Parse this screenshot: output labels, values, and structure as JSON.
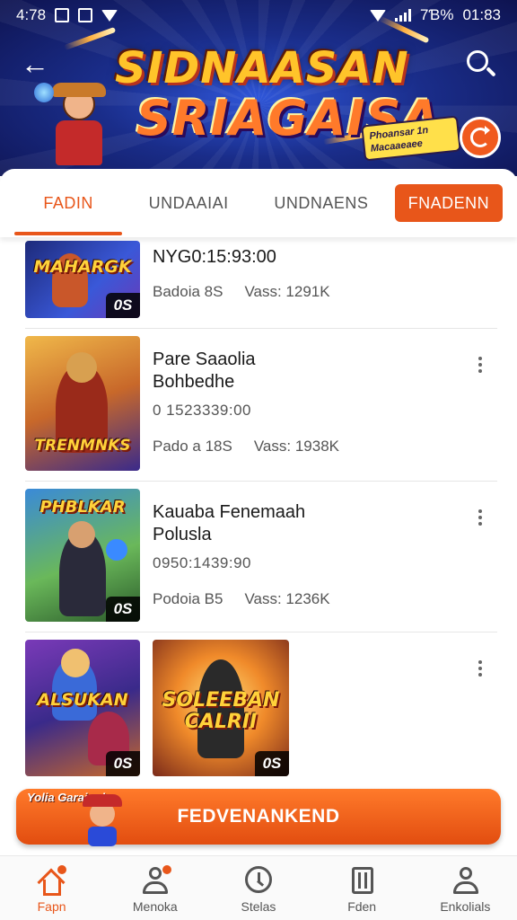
{
  "status_bar": {
    "time": "4:78",
    "battery": "7Ɓ%",
    "clock": "01:83"
  },
  "banner": {
    "title_line1": "SIDNAASAN",
    "title_line2": "SRIAGAISA",
    "promo_tag": "Phoansar 1n Macaaeaee",
    "icons": {
      "back": "arrow-left-icon",
      "search": "search-icon",
      "refresh": "refresh-icon"
    }
  },
  "tabs": [
    {
      "label": "FADIN",
      "active": true
    },
    {
      "label": "UNDAAIAI",
      "active": false
    },
    {
      "label": "UNDNAENS",
      "active": false
    },
    {
      "label": "FNADENN",
      "highlighted": true
    }
  ],
  "items": [
    {
      "thumb_title": "MAHARGK",
      "badge": "0S",
      "name_line1": "NYG0:15:93:00",
      "name_line2": "",
      "time": "",
      "meta_left": "Badoia 8S",
      "meta_right": "Vass: 1291K"
    },
    {
      "thumb_title": "TRENMNKS",
      "badge": "",
      "name_line1": "Pare Saaolia",
      "name_line2": "Bohbedhe",
      "time": "0 1523339:00",
      "meta_left": "Pado a 18S",
      "meta_right": "Vass: 1938K"
    },
    {
      "thumb_title": "PHBLKAR",
      "badge": "0S",
      "name_line1": "Kauaba Fenemaah",
      "name_line2": "Polusla",
      "time": "0950:1439:90",
      "meta_left": "Podoia B5",
      "meta_right": "Vass: 1236K"
    },
    {
      "thumb_title": "ALSUKAN",
      "badge": "0S",
      "thumb2_title": "SOLEEBAN CALRII",
      "thumb2_badge": "0S"
    }
  ],
  "cta": {
    "art_text": "Yolia Garaiuol",
    "label": "FEDVENANKEND"
  },
  "bottom_nav": [
    {
      "label": "Fapn",
      "icon": "home-icon",
      "active": true
    },
    {
      "label": "Menoka",
      "icon": "user-icon",
      "active": false
    },
    {
      "label": "Stelas",
      "icon": "clock-icon",
      "active": false
    },
    {
      "label": "Fden",
      "icon": "box-icon",
      "active": false
    },
    {
      "label": "Enkolials",
      "icon": "profile-icon",
      "active": false
    }
  ],
  "colors": {
    "accent": "#e8561a",
    "banner_dark": "#0e1350",
    "banner_mid": "#2f56d8",
    "text_primary": "#1a1a1a",
    "text_secondary": "#555555"
  }
}
